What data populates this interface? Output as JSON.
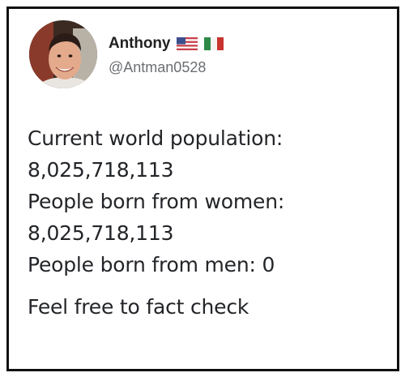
{
  "tweet": {
    "author": {
      "display_name": "Anthony",
      "handle": "@Antman0528",
      "avatar": "profile-photo",
      "flags": [
        "us-flag-icon",
        "italy-flag-icon"
      ]
    },
    "lines": [
      "Current world population:",
      "8,025,718,113",
      "People born from women:",
      "8,025,718,113",
      "People born from men: 0",
      "Feel free to fact check"
    ]
  },
  "colors": {
    "text": "#232528",
    "handle": "#6b6f73",
    "border": "#111111",
    "background": "#ffffff"
  }
}
